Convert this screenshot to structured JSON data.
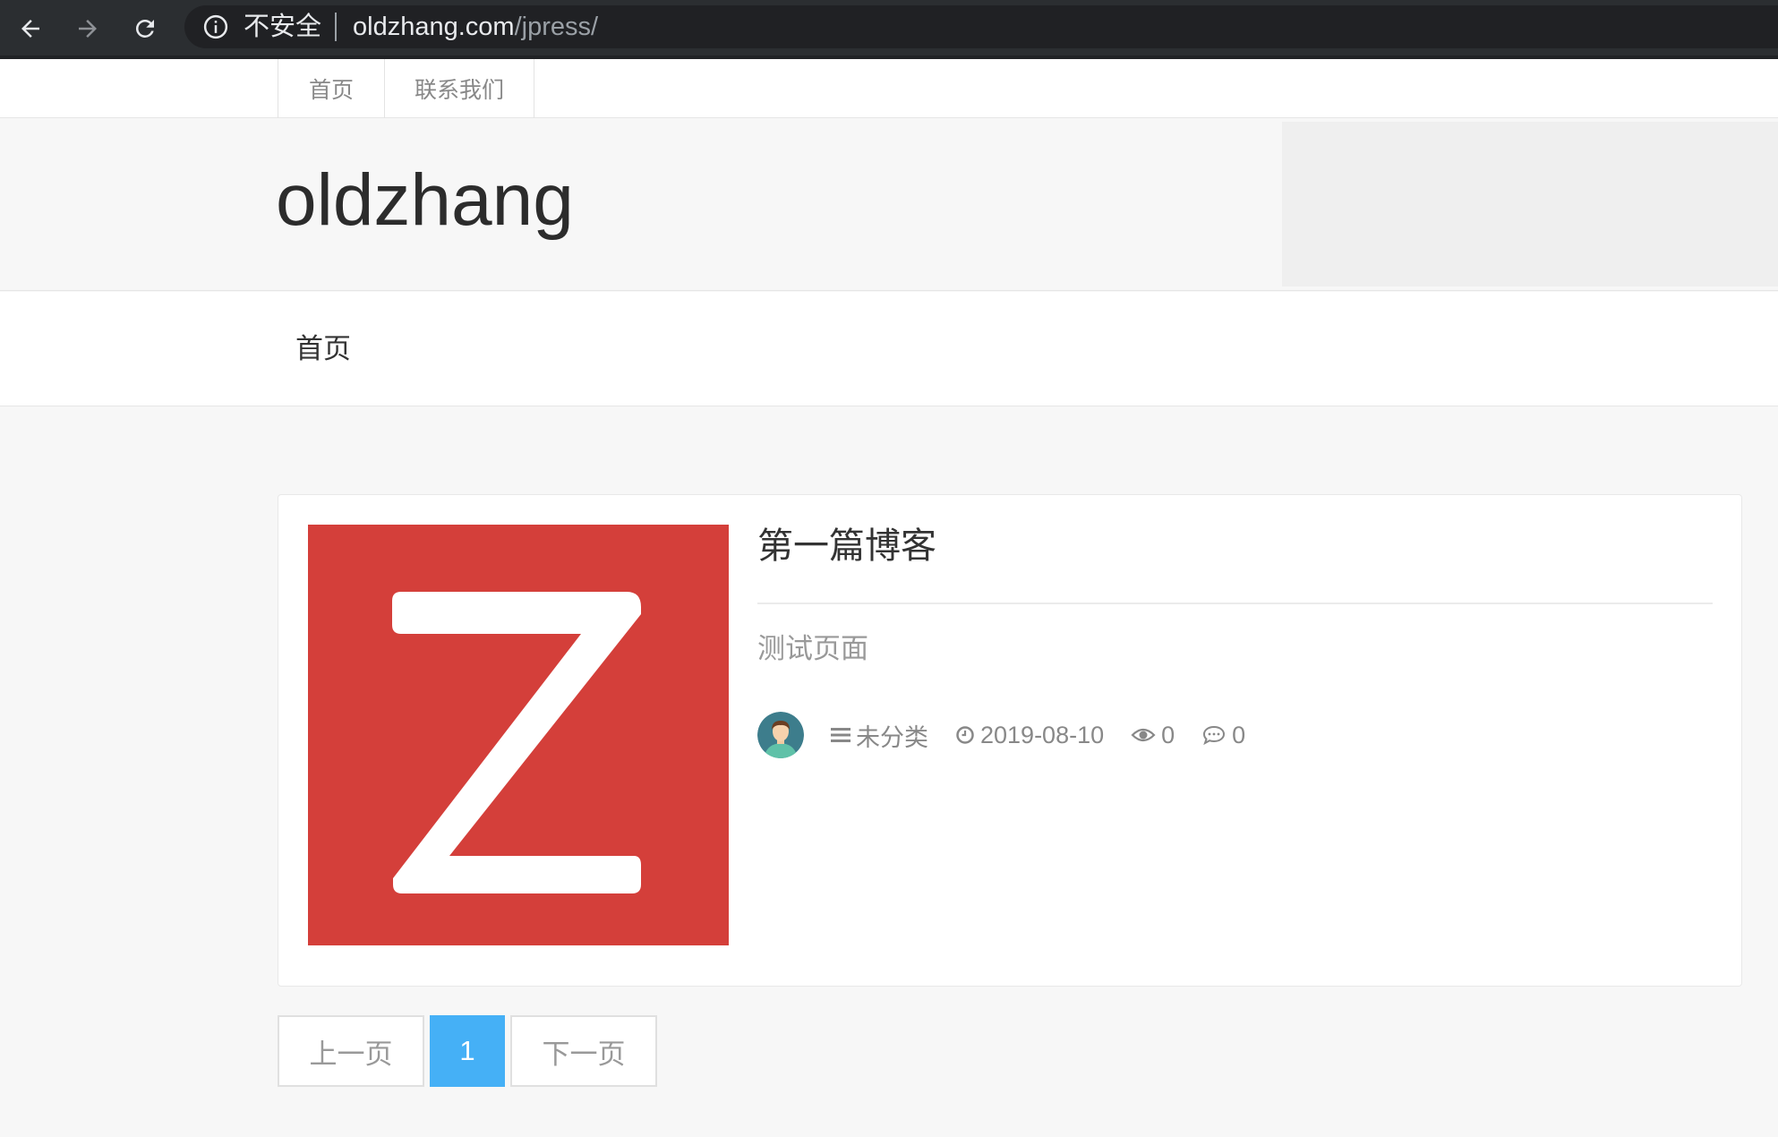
{
  "browser": {
    "security_label": "不安全",
    "url_host": "oldzhang.com",
    "url_path": "/jpress/"
  },
  "topnav": {
    "items": [
      {
        "label": "首页"
      },
      {
        "label": "联系我们"
      }
    ]
  },
  "header": {
    "site_title": "oldzhang"
  },
  "mainnav": {
    "items": [
      {
        "label": "首页"
      }
    ]
  },
  "post": {
    "thumbnail_letter": "Z",
    "title": "第一篇博客",
    "summary": "测试页面",
    "category": "未分类",
    "date": "2019-08-10",
    "views": "0",
    "comments": "0"
  },
  "pagination": {
    "prev_label": "上一页",
    "current_page": "1",
    "next_label": "下一页"
  },
  "colors": {
    "thumbnail_bg": "#d43f3a",
    "active_page": "#45b0f6"
  }
}
